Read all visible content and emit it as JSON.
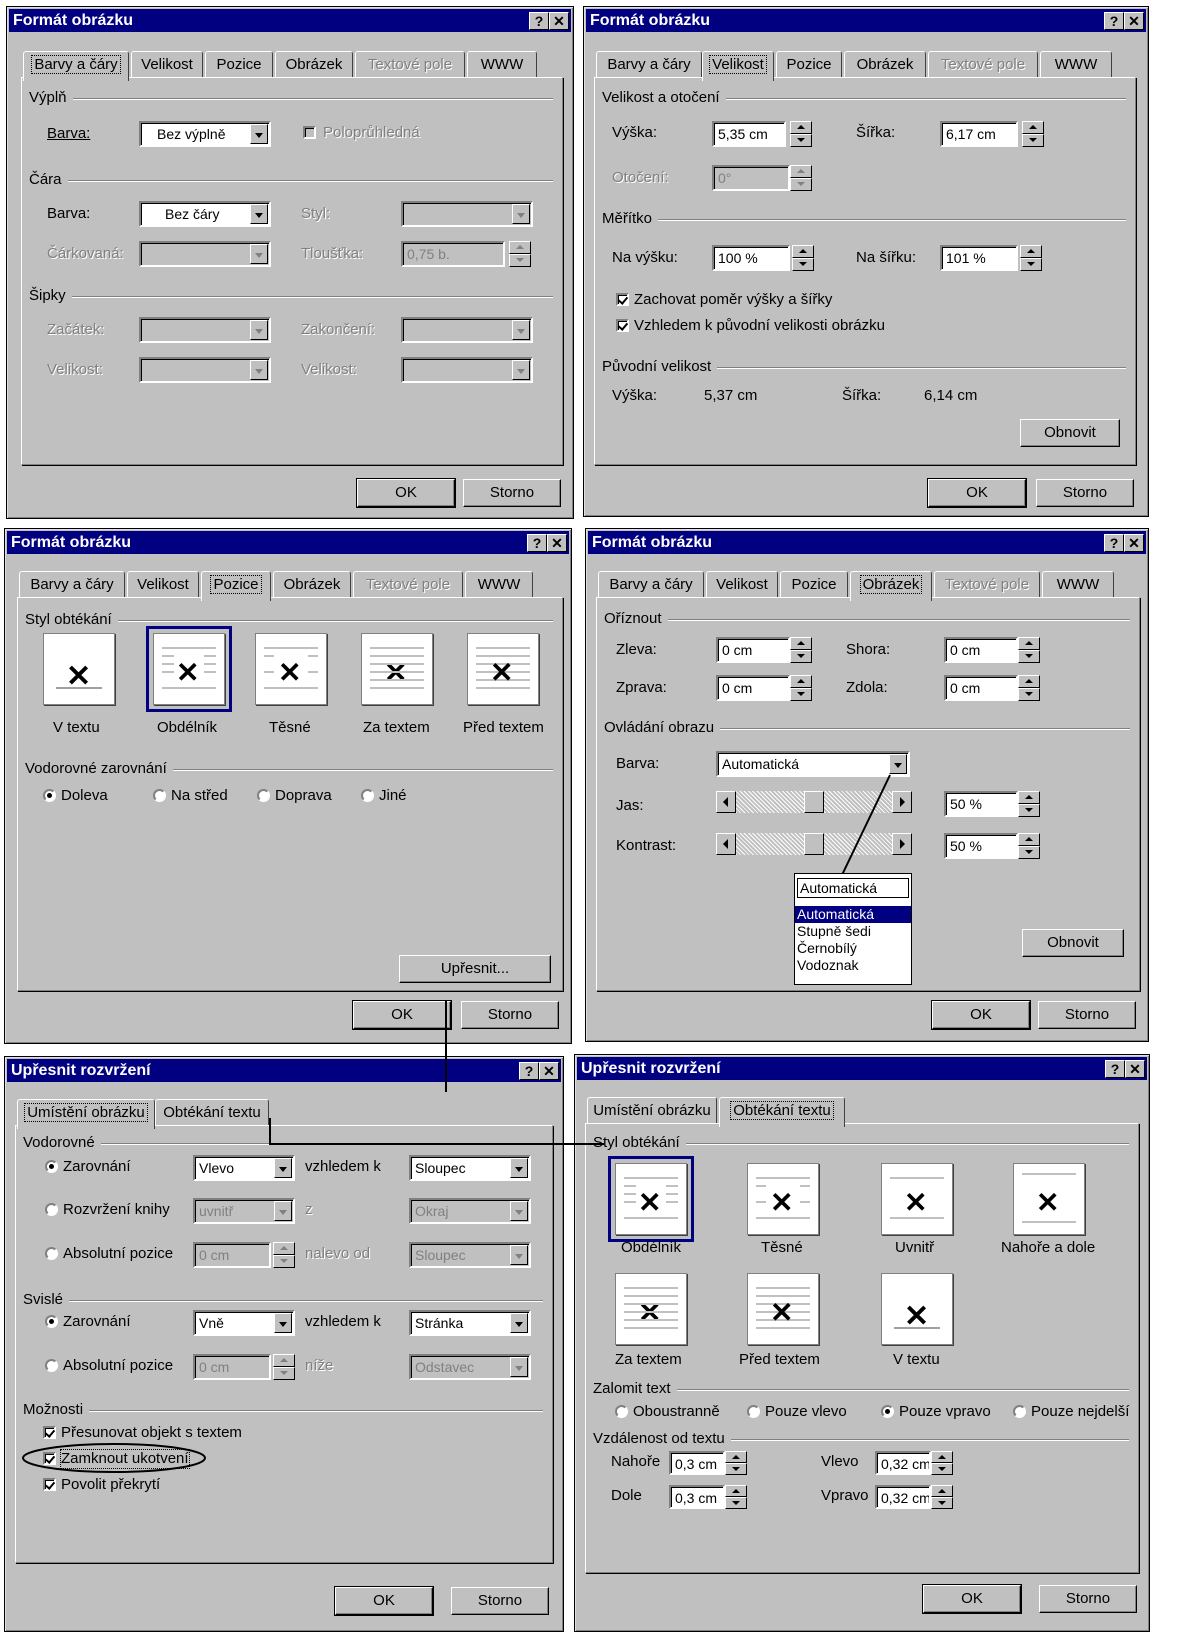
{
  "common": {
    "help": "?",
    "close": "✕",
    "ok": "OK",
    "cancel": "Storno"
  },
  "d1": {
    "title": "Formát obrázku",
    "tabs": [
      "Barvy a čáry",
      "Velikost",
      "Pozice",
      "Obrázek",
      "Textové pole",
      "WWW"
    ],
    "fill_section": "Výplň",
    "fill_color_label": "Barva:",
    "fill_color_value": "Bez výplně",
    "semitransparent": "Poloprůhledná",
    "line_section": "Čára",
    "line_color_label": "Barva:",
    "line_color_value": "Bez čáry",
    "style_label": "Styl:",
    "dashed_label": "Čárkovaná:",
    "weight_label": "Tloušťka:",
    "weight_value": "0,75 b.",
    "arrows_section": "Šipky",
    "begin_label": "Začátek:",
    "end_label": "Zakončení:",
    "size1_label": "Velikost:",
    "size2_label": "Velikost:"
  },
  "d2": {
    "title": "Formát obrázku",
    "tabs": [
      "Barvy a čáry",
      "Velikost",
      "Pozice",
      "Obrázek",
      "Textové pole",
      "WWW"
    ],
    "size_section": "Velikost a otočení",
    "height_label": "Výška:",
    "height_value": "5,35 cm",
    "width_label": "Šířka:",
    "width_value": "6,17 cm",
    "rotation_label": "Otočení:",
    "rotation_value": "0°",
    "scale_section": "Měřítko",
    "scale_h_label": "Na výšku:",
    "scale_h_value": "100 %",
    "scale_w_label": "Na šířku:",
    "scale_w_value": "101 %",
    "lock_ratio": "Zachovat poměr výšky a šířky",
    "relative_orig": "Vzhledem k původní velikosti obrázku",
    "orig_section": "Původní velikost",
    "orig_h_label": "Výška:",
    "orig_h_value": "5,37 cm",
    "orig_w_label": "Šířka:",
    "orig_w_value": "6,14 cm",
    "reset": "Obnovit"
  },
  "d3": {
    "title": "Formát obrázku",
    "tabs": [
      "Barvy a čáry",
      "Velikost",
      "Pozice",
      "Obrázek",
      "Textové pole",
      "WWW"
    ],
    "wrap_section": "Styl obtékání",
    "wrap_styles": [
      "V textu",
      "Obdélník",
      "Těsné",
      "Za textem",
      "Před textem"
    ],
    "halign_section": "Vodorovné zarovnání",
    "halign_options": [
      "Doleva",
      "Na střed",
      "Doprava",
      "Jiné"
    ],
    "advanced": "Upřesnit..."
  },
  "d4": {
    "title": "Formát obrázku",
    "tabs": [
      "Barvy a čáry",
      "Velikost",
      "Pozice",
      "Obrázek",
      "Textové pole",
      "WWW"
    ],
    "crop_section": "Oříznout",
    "left_label": "Zleva:",
    "left_value": "0 cm",
    "top_label": "Shora:",
    "top_value": "0 cm",
    "right_label": "Zprava:",
    "right_value": "0 cm",
    "bottom_label": "Zdola:",
    "bottom_value": "0 cm",
    "control_section": "Ovládání obrazu",
    "color_label": "Barva:",
    "color_value": "Automatická",
    "brightness_label": "Jas:",
    "brightness_value": "50 %",
    "contrast_label": "Kontrast:",
    "contrast_value": "50 %",
    "popup_current": "Automatická",
    "popup_items": [
      "Automatická",
      "Stupně šedi",
      "Černobílý",
      "Vodoznak"
    ],
    "reset": "Obnovit"
  },
  "d5": {
    "title": "Upřesnit rozvržení",
    "tabs": [
      "Umístění obrázku",
      "Obtékání textu"
    ],
    "horizontal_section": "Vodorovné",
    "h_align": "Zarovnání",
    "h_align_value": "Vlevo",
    "h_rel": "vzhledem k",
    "h_rel_value": "Sloupec",
    "h_book": "Rozvržení knihy",
    "h_book_value": "uvnitř",
    "h_book_rel": "z",
    "h_book_rel_value": "Okraj",
    "h_abs": "Absolutní pozice",
    "h_abs_value": "0 cm",
    "h_abs_rel": "nalevo od",
    "h_abs_rel_value": "Sloupec",
    "vertical_section": "Svislé",
    "v_align": "Zarovnání",
    "v_align_value": "Vně",
    "v_rel": "vzhledem k",
    "v_rel_value": "Stránka",
    "v_abs": "Absolutní pozice",
    "v_abs_value": "0 cm",
    "v_abs_rel": "níže",
    "v_abs_rel_value": "Odstavec",
    "options_section": "Možnosti",
    "opt_move": "Přesunovat objekt s textem",
    "opt_lock": "Zamknout ukotvení",
    "opt_overlap": "Povolit překrytí"
  },
  "d6": {
    "title": "Upřesnit rozvržení",
    "tabs": [
      "Umístění obrázku",
      "Obtékání textu"
    ],
    "wrap_section": "Styl obtékání",
    "wrap_styles": [
      "Obdélník",
      "Těsné",
      "Uvnitř",
      "Nahoře a dole",
      "Za textem",
      "Před textem",
      "V textu"
    ],
    "wrap_text_section": "Zalomit text",
    "wrap_text_options": [
      "Oboustranně",
      "Pouze vlevo",
      "Pouze vpravo",
      "Pouze nejdelší"
    ],
    "distance_section": "Vzdálenost od textu",
    "top_label": "Nahoře",
    "top_value": "0,3 cm",
    "bottom_label": "Dole",
    "bottom_value": "0,3 cm",
    "left_label": "Vlevo",
    "left_value": "0,32 cm",
    "right_label": "Vpravo",
    "right_value": "0,32 cm"
  }
}
